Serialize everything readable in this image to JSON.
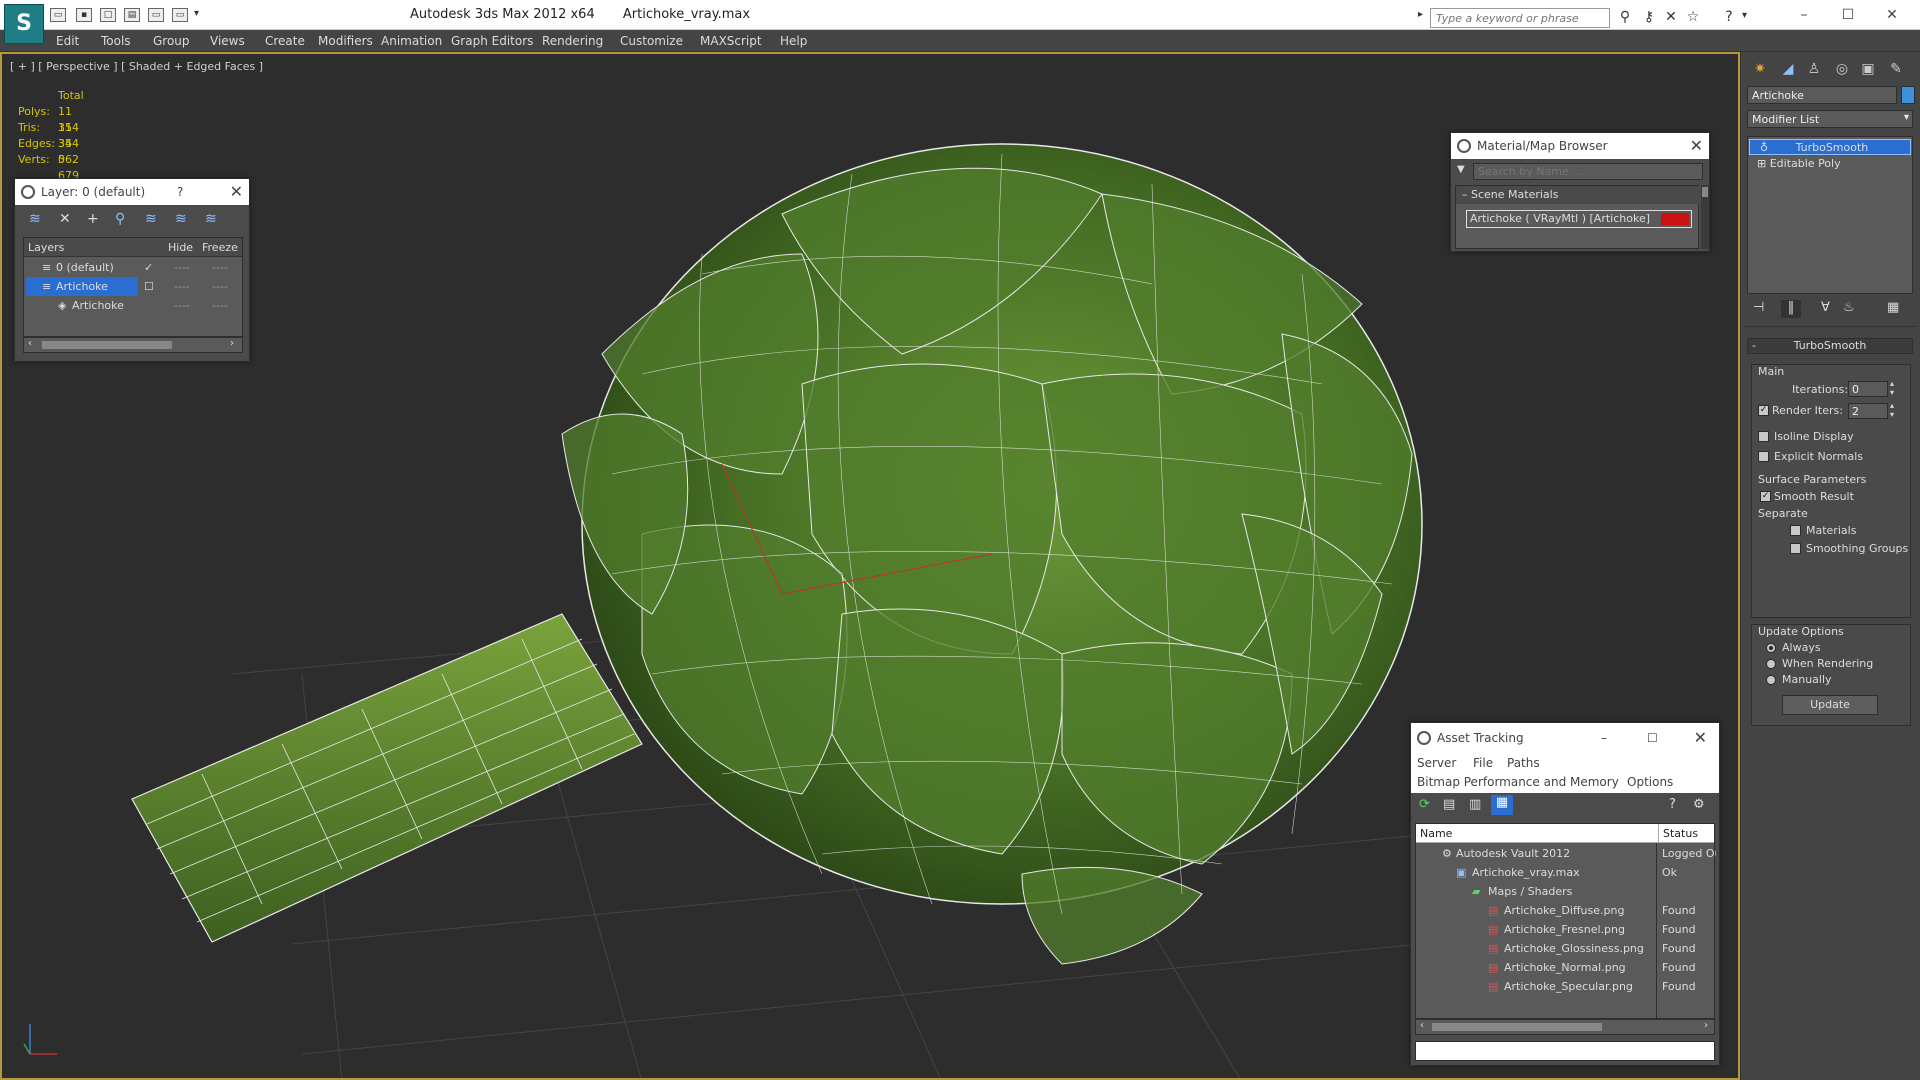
{
  "app": {
    "title": "Autodesk 3ds Max  2012 x64",
    "file": "Artichoke_vray.max",
    "logo": "S"
  },
  "search": {
    "placeholder": "Type a keyword or phrase"
  },
  "menu": [
    "Edit",
    "Tools",
    "Group",
    "Views",
    "Create",
    "Modifiers",
    "Animation",
    "Graph Editors",
    "Rendering",
    "Customize",
    "MAXScript",
    "Help"
  ],
  "viewport": {
    "label": "[ + ] [ Perspective ] [ Shaded + Edged Faces ]",
    "stats_header": "Total",
    "stats": [
      {
        "label": "Polys:",
        "value": "11 354"
      },
      {
        "label": "Tris:",
        "value": "11 354"
      },
      {
        "label": "Edges:",
        "value": "34 062"
      },
      {
        "label": "Verts:",
        "value": "5 679"
      }
    ]
  },
  "layer_window": {
    "title": "Layer: 0 (default)",
    "help": "?",
    "columns": [
      "Layers",
      "Hide",
      "Freeze"
    ],
    "rows": [
      {
        "name": "0 (default)",
        "active": true,
        "selected": false,
        "indent": 0
      },
      {
        "name": "Artichoke",
        "active": false,
        "selected": true,
        "indent": 0
      },
      {
        "name": "Artichoke",
        "active": false,
        "selected": false,
        "indent": 1
      }
    ]
  },
  "material_browser": {
    "title": "Material/Map Browser",
    "search_placeholder": "Search by Name ...",
    "group": "Scene Materials",
    "item": "Artichoke  ( VRayMtl )  [Artichoke]",
    "swatch_color": "#cc1111"
  },
  "command_panel": {
    "object_name": "Artichoke",
    "object_color": "#3d8fe0",
    "modifier_list": "Modifier List",
    "stack": [
      {
        "name": "TurboSmooth",
        "selected": true
      },
      {
        "name": "Editable Poly",
        "selected": false
      }
    ],
    "rollout_title": "TurboSmooth",
    "main_group": "Main",
    "iterations_label": "Iterations:",
    "iterations_value": "0",
    "render_iters_label": "Render Iters:",
    "render_iters_value": "2",
    "render_iters_checked": true,
    "isoline_label": "Isoline Display",
    "explicit_label": "Explicit Normals",
    "surface_group": "Surface Parameters",
    "smooth_label": "Smooth Result",
    "separate_label": "Separate",
    "materials_label": "Materials",
    "smoothing_label": "Smoothing Groups",
    "update_group": "Update Options",
    "radio_options": [
      "Always",
      "When Rendering",
      "Manually"
    ],
    "radio_selected": 0,
    "update_button": "Update"
  },
  "asset_tracking": {
    "title": "Asset Tracking",
    "menu": [
      "Server",
      "File",
      "Paths"
    ],
    "menu2": [
      "Bitmap Performance and Memory",
      "Options"
    ],
    "columns": [
      "Name",
      "Status"
    ],
    "rows": [
      {
        "name": "Autodesk Vault 2012",
        "status": "Logged Ou",
        "indent": 0,
        "icon": "vault"
      },
      {
        "name": "Artichoke_vray.max",
        "status": "Ok",
        "indent": 1,
        "icon": "max"
      },
      {
        "name": "Maps / Shaders",
        "status": "",
        "indent": 2,
        "icon": "folder"
      },
      {
        "name": "Artichoke_Diffuse.png",
        "status": "Found",
        "indent": 3,
        "icon": "png"
      },
      {
        "name": "Artichoke_Fresnel.png",
        "status": "Found",
        "indent": 3,
        "icon": "png"
      },
      {
        "name": "Artichoke_Glossiness.png",
        "status": "Found",
        "indent": 3,
        "icon": "png"
      },
      {
        "name": "Artichoke_Normal.png",
        "status": "Found",
        "indent": 3,
        "icon": "png"
      },
      {
        "name": "Artichoke_Specular.png",
        "status": "Found",
        "indent": 3,
        "icon": "png"
      }
    ]
  }
}
